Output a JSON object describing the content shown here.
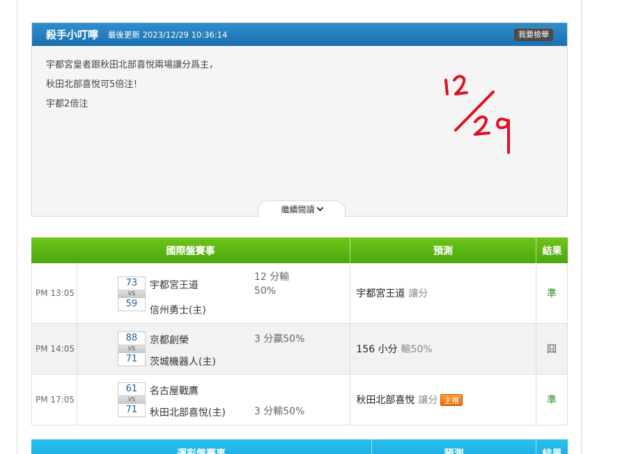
{
  "post": {
    "author": "殺手小叮嚀",
    "updated": "最後更新 2023/12/29 10:36:14",
    "report_button": "我要檢舉",
    "lines": [
      "宇都宮皇者跟秋田北部喜悅兩場讓分爲主，",
      "秋田北部喜悅可5倍注！",
      "宇都2倍注"
    ],
    "handwriting": "12/29",
    "read_more": "繼續閱讀"
  },
  "international": {
    "headers": {
      "game": "國際盤賽事",
      "prediction": "預測",
      "result": "結果"
    },
    "rows": [
      {
        "time": "PM 13:05",
        "away_score": "73",
        "vs": "VS",
        "home_score": "59",
        "away_team": "宇都宮王道",
        "home_team": "信州勇士(主)",
        "odds_line1": "12 分輸",
        "odds_line2": "50%",
        "prediction": "宇都宮王道",
        "prediction_type": "讓分",
        "badge": "",
        "result": "準"
      },
      {
        "time": "PM 14:05",
        "away_score": "88",
        "vs": "VS",
        "home_score": "71",
        "away_team": "京都創榮",
        "home_team": "茨城機器人(主)",
        "odds_line1": "3 分贏50%",
        "odds_line2": "",
        "prediction": "156 小分",
        "prediction_type": "輸50%",
        "badge": "",
        "result": "囧"
      },
      {
        "time": "PM 17:05",
        "away_score": "61",
        "vs": "VS",
        "home_score": "71",
        "away_team": "名古屋戰鷹",
        "home_team": "秋田北部喜悅(主)",
        "odds_line1": "3 分輸50%",
        "odds_line2": "",
        "prediction": "秋田北部喜悅",
        "prediction_type": "讓分",
        "badge": "主推",
        "result": "準"
      }
    ]
  },
  "lottery": {
    "headers": {
      "game": "運彩盤賽事",
      "prediction": "預測",
      "result": "結果"
    }
  },
  "colors": {
    "header_blue": "#1b6fae",
    "header_green": "#4aa80c",
    "header_cyan": "#13a4dd",
    "win_green": "#2d8a22",
    "badge_orange": "#e86b00",
    "handwriting_red": "#e01020"
  }
}
